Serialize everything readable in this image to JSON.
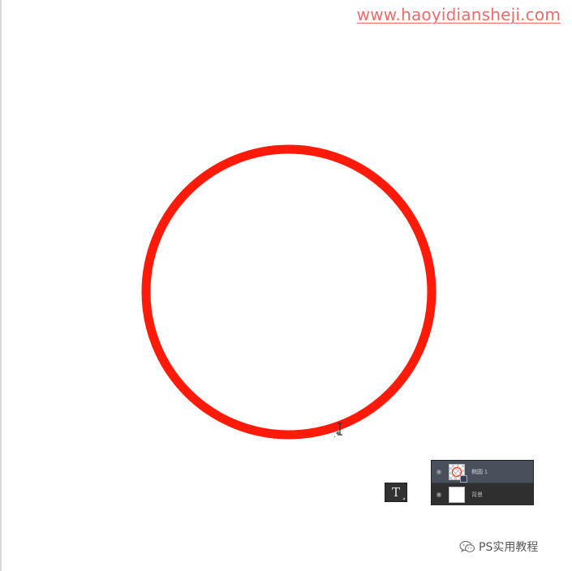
{
  "watermark": {
    "text": "www.haoyidiansheji.com",
    "color": "#ee6b6b"
  },
  "canvas": {
    "background": "#ffffff",
    "shape": {
      "type": "ring",
      "stroke_color": "#ff1a0a"
    }
  },
  "cursor": {
    "icon": "text-cursor-icon"
  },
  "tools": {
    "type_tool": {
      "label": "T",
      "icon": "type-tool-icon"
    }
  },
  "layers": {
    "items": [
      {
        "name": "椭圆 1",
        "icon": "eye-icon",
        "selected": true,
        "thumbnail": "transparent-ring"
      },
      {
        "name": "背景",
        "icon": "eye-icon",
        "selected": false,
        "thumbnail": "white"
      }
    ],
    "selected_color": "#4a4f5c"
  },
  "footer": {
    "icon": "wechat-icon",
    "text": "PS实用教程"
  }
}
